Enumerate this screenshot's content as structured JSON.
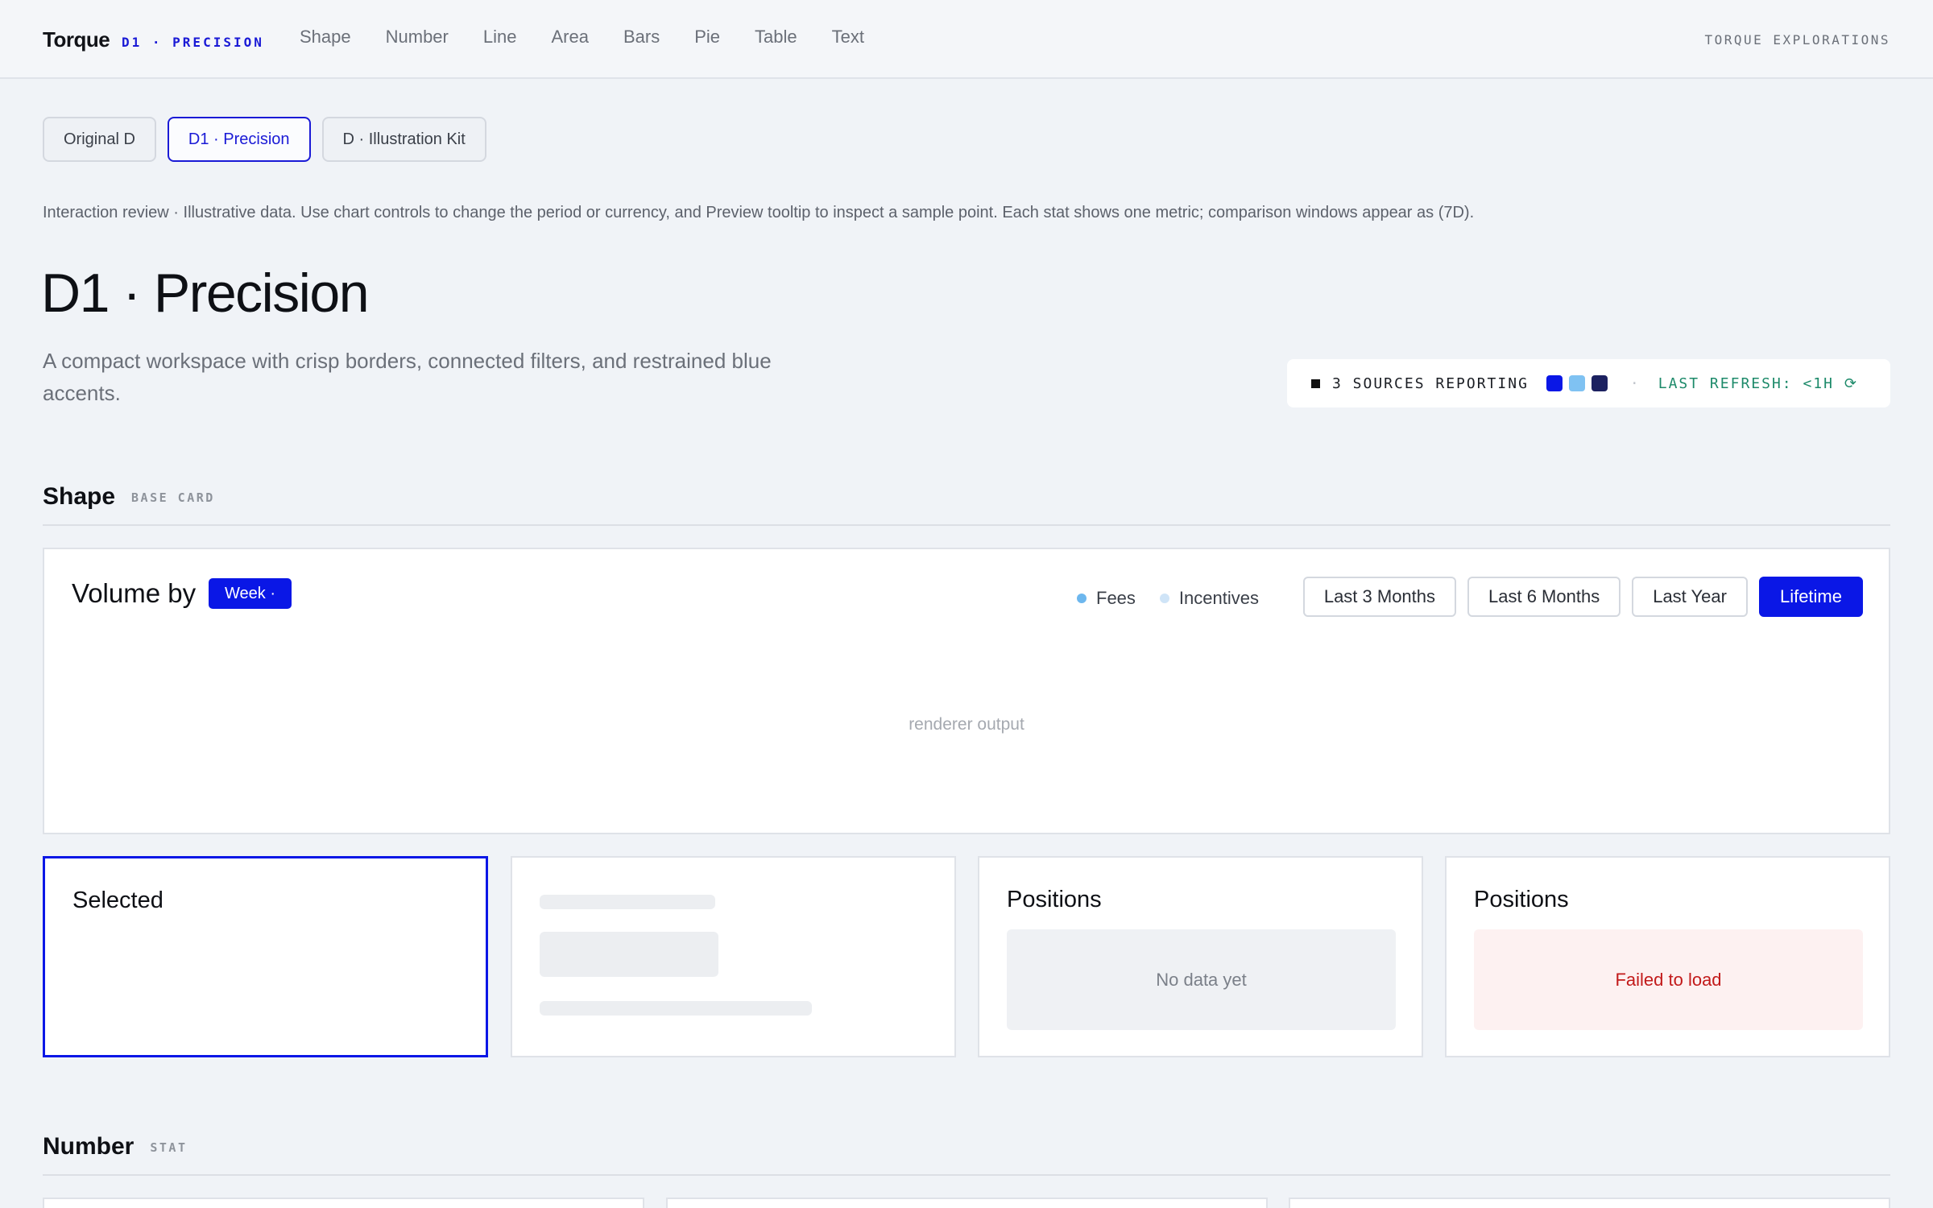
{
  "nav": {
    "brand": "Torque",
    "brand_tag": "D1 · PRECISION",
    "items": [
      "Shape",
      "Number",
      "Line",
      "Area",
      "Bars",
      "Pie",
      "Table",
      "Text"
    ],
    "right_label": "TORQUE EXPLORATIONS"
  },
  "variants": [
    {
      "label": "Original D",
      "active": false
    },
    {
      "label": "D1 · Precision",
      "active": true
    },
    {
      "label": "D · Illustration Kit",
      "active": false
    }
  ],
  "intro": "Interaction review · Illustrative data. Use chart controls to change the period or currency, and Preview tooltip to inspect a sample point. Each stat shows one metric; comparison windows appear as (7D).",
  "page": {
    "title": "D1 · Precision",
    "subtitle": "A compact workspace with crisp borders, connected filters, and restrained blue accents."
  },
  "status": {
    "sources": "3 SOURCES REPORTING",
    "swatches": [
      "#0a17e6",
      "#7fc2f2",
      "#1c2160"
    ],
    "separator": "·",
    "refresh": "LAST REFRESH: <1H ⟳"
  },
  "sections": {
    "shape": {
      "title": "Shape",
      "kicker": "BASE CARD"
    },
    "number": {
      "title": "Number",
      "kicker": "STAT"
    }
  },
  "chart_card": {
    "title": "Volume by",
    "group_pill": "Week ·",
    "legend": [
      {
        "label": "Fees",
        "color": "#6db7ee"
      },
      {
        "label": "Incentives",
        "color": "#cfe4f7"
      }
    ],
    "ranges": [
      {
        "label": "Last 3 Months",
        "active": false
      },
      {
        "label": "Last 6 Months",
        "active": false
      },
      {
        "label": "Last Year",
        "active": false
      },
      {
        "label": "Lifetime",
        "active": true
      }
    ],
    "placeholder": "renderer output"
  },
  "states": {
    "selected": {
      "title": "Selected"
    },
    "empty": {
      "title": "Positions",
      "message": "No data yet"
    },
    "error": {
      "title": "Positions",
      "message": "Failed to load"
    }
  },
  "colors": {
    "accent": "#0a17e6",
    "refresh": "#1d8a6a",
    "error": "#c21a1a"
  }
}
